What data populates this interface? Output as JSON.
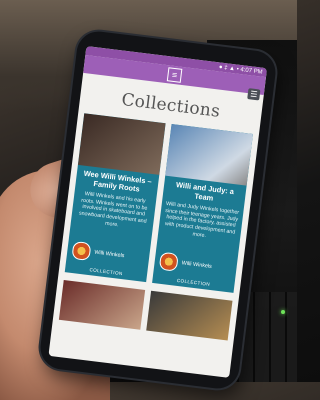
{
  "status": {
    "text": "● ‡ ▲ • 4:07 PM"
  },
  "app": {
    "menu_icon": "menu-icon",
    "list_icon": "list-view-icon",
    "title": "Collections"
  },
  "cards": [
    {
      "title": "Wee Willi Winkels – Family Roots",
      "description": "Willi Winkels and his early roots. Winkels went on to be involved in skateboard and snowboard development and more.",
      "author": "Willi Winkels",
      "label": "COLLECTION"
    },
    {
      "title": "Willi and Judy: a Team",
      "description": "Willi and Judy Winkels together since their teenage years. Judy helped in the factory, assisted with product development and more.",
      "author": "Willi Winkels",
      "label": "COLLECTION"
    }
  ],
  "colors": {
    "appbar": "#9d5fb7",
    "card": "#1c7b93",
    "screen_bg": "#f2f1ee"
  }
}
